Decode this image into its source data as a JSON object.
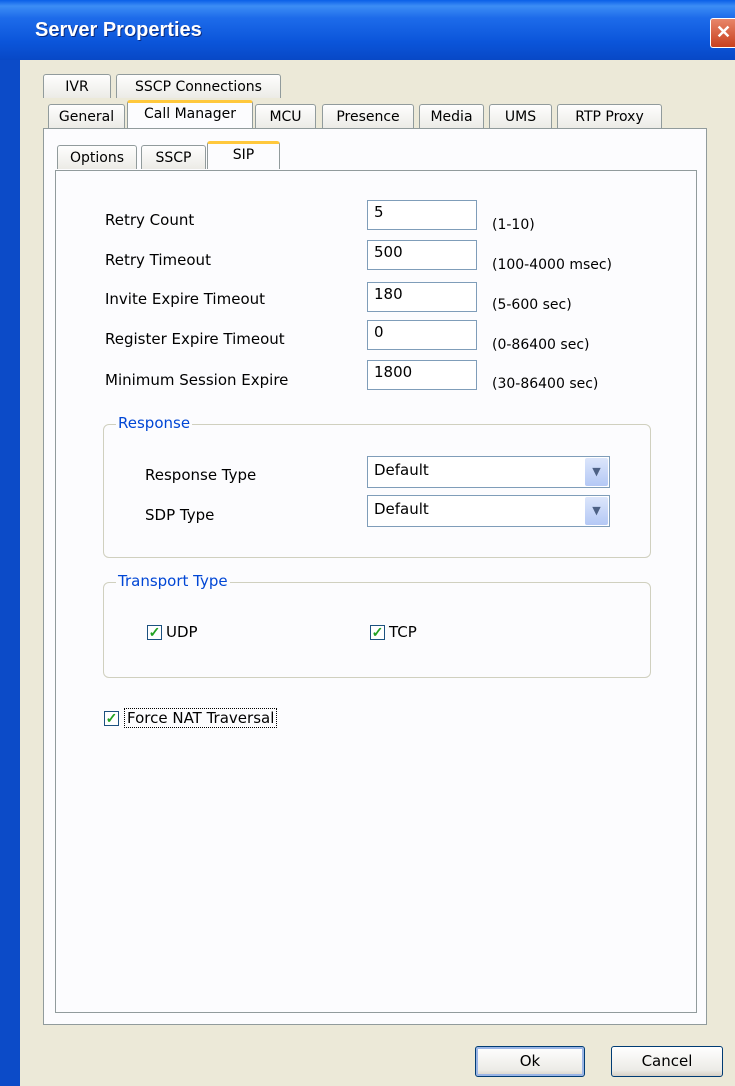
{
  "window": {
    "title": "Server Properties",
    "close_glyph": "✕"
  },
  "tabs_row1": [
    "IVR",
    "SSCP Connections"
  ],
  "tabs_row2": [
    "General",
    "Call Manager",
    "MCU",
    "Presence",
    "Media",
    "UMS",
    "RTP Proxy"
  ],
  "subtabs": [
    "Options",
    "SSCP",
    "SIP"
  ],
  "fields": [
    {
      "label": "Retry Count",
      "value": "5",
      "hint": "(1-10)"
    },
    {
      "label": "Retry Timeout",
      "value": "500",
      "hint": "(100-4000 msec)"
    },
    {
      "label": "Invite Expire Timeout",
      "value": "180",
      "hint": "(5-600 sec)"
    },
    {
      "label": "Register Expire Timeout",
      "value": "0",
      "hint": "(0-86400 sec)"
    },
    {
      "label": "Minimum Session Expire",
      "value": "1800",
      "hint": "(30-86400 sec)"
    }
  ],
  "response": {
    "legend": "Response",
    "response_type_label": "Response Type",
    "response_type_value": "Default",
    "sdp_type_label": "SDP Type",
    "sdp_type_value": "Default"
  },
  "transport": {
    "legend": "Transport Type",
    "udp_label": "UDP",
    "udp_checked": true,
    "tcp_label": "TCP",
    "tcp_checked": true
  },
  "force_nat": {
    "label": "Force NAT Traversal",
    "checked": true
  },
  "buttons": {
    "ok": "Ok",
    "cancel": "Cancel"
  },
  "colors": {
    "accent": "#0046D5",
    "title_bar": "#0B55DA",
    "tab_highlight": "#FFC83C",
    "check_green": "#21A121"
  }
}
